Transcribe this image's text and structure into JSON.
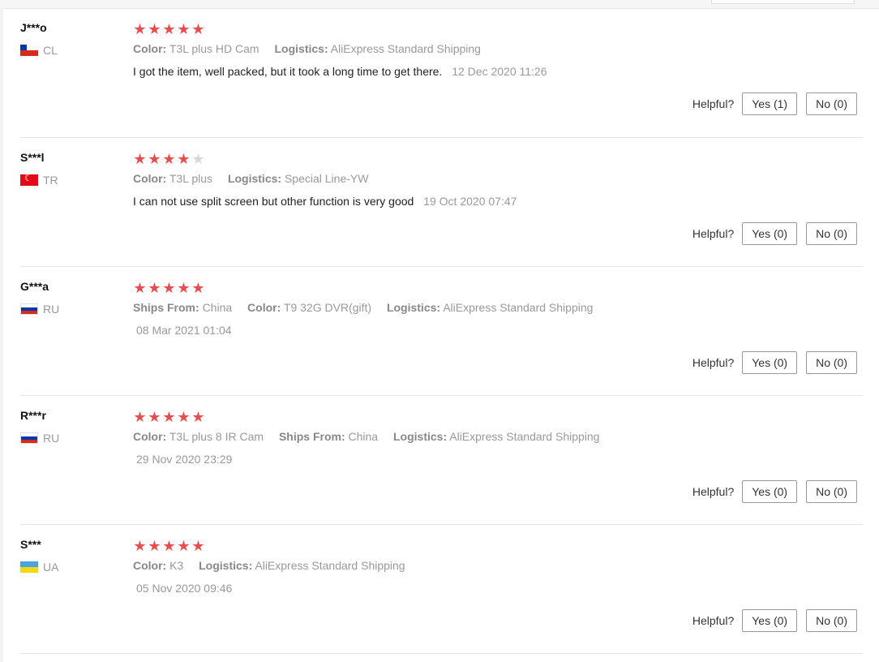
{
  "reviews": [
    {
      "user": "J***o",
      "country": "CL",
      "flag": "chile-flag-icon",
      "rating": 5,
      "meta": [
        {
          "key": "Color:",
          "value": "T3L plus HD Cam"
        },
        {
          "key": "Logistics:",
          "value": "AliExpress Standard Shipping"
        }
      ],
      "text": "I got the item, well packed, but it took a long time to get there.",
      "date": "12 Dec 2020 11:26",
      "helpful_label": "Helpful?",
      "yes_label": "Yes (1)",
      "no_label": "No (0)"
    },
    {
      "user": "S***l",
      "country": "TR",
      "flag": "turkey-flag-icon",
      "rating": 4,
      "meta": [
        {
          "key": "Color:",
          "value": "T3L plus"
        },
        {
          "key": "Logistics:",
          "value": "Special Line-YW"
        }
      ],
      "text": "I can not use split screen but other function is very good",
      "date": "19 Oct 2020 07:47",
      "helpful_label": "Helpful?",
      "yes_label": "Yes (0)",
      "no_label": "No (0)"
    },
    {
      "user": "G***a",
      "country": "RU",
      "flag": "russia-flag-icon",
      "rating": 5,
      "meta": [
        {
          "key": "Ships From:",
          "value": "China"
        },
        {
          "key": "Color:",
          "value": "T9 32G DVR(gift)"
        },
        {
          "key": "Logistics:",
          "value": "AliExpress Standard Shipping"
        }
      ],
      "text": "",
      "date": "08 Mar 2021 01:04",
      "helpful_label": "Helpful?",
      "yes_label": "Yes (0)",
      "no_label": "No (0)"
    },
    {
      "user": "R***r",
      "country": "RU",
      "flag": "russia-flag-icon",
      "rating": 5,
      "meta": [
        {
          "key": "Color:",
          "value": "T3L plus 8 IR Cam"
        },
        {
          "key": "Ships From:",
          "value": "China"
        },
        {
          "key": "Logistics:",
          "value": "AliExpress Standard Shipping"
        }
      ],
      "text": "",
      "date": "29 Nov 2020 23:29",
      "helpful_label": "Helpful?",
      "yes_label": "Yes (0)",
      "no_label": "No (0)"
    },
    {
      "user": "S***",
      "country": "UA",
      "flag": "ukraine-flag-icon",
      "rating": 5,
      "meta": [
        {
          "key": "Color:",
          "value": "K3"
        },
        {
          "key": "Logistics:",
          "value": "AliExpress Standard Shipping"
        }
      ],
      "text": "",
      "date": "05 Nov 2020 09:46",
      "helpful_label": "Helpful?",
      "yes_label": "Yes (0)",
      "no_label": "No (0)"
    }
  ],
  "colors": {
    "star_on": "#e84d4d",
    "star_off": "#d6d6d6",
    "muted_text": "#999999"
  }
}
